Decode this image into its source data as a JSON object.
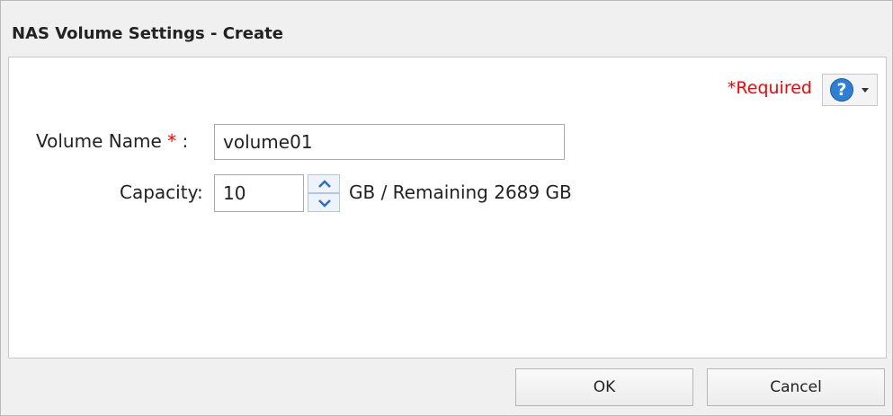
{
  "dialog": {
    "title": "NAS Volume Settings - Create"
  },
  "form": {
    "required_note": "*Required",
    "help_icon": "question-mark-icon",
    "volume_name": {
      "label": "Volume Name",
      "required_marker": "*",
      "colon": " :",
      "value": "volume01"
    },
    "capacity": {
      "label": "Capacity:",
      "value": "10",
      "suffix": "GB / Remaining 2689 GB"
    }
  },
  "buttons": {
    "ok_label": "OK",
    "cancel_label": "Cancel"
  },
  "colors": {
    "required": "#ff0000",
    "help_icon": "#2c7ed6",
    "spinner_arrow": "#2a6ebf"
  }
}
